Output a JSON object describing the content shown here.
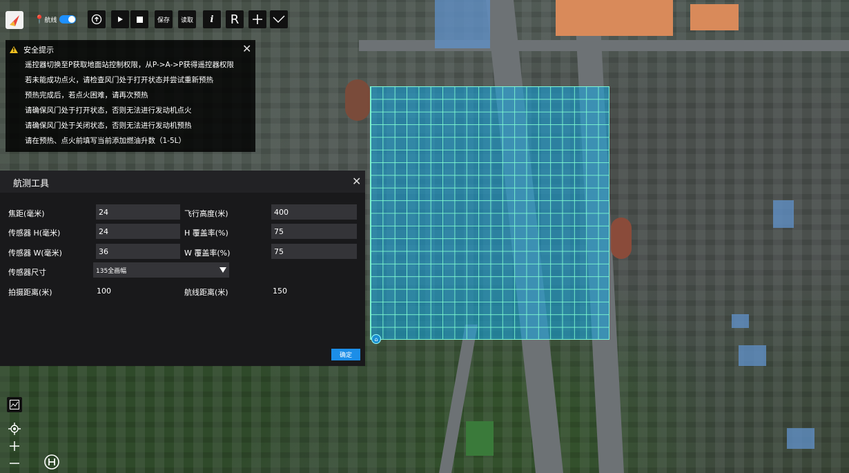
{
  "toolbar": {
    "route_label": "航线",
    "save_label": "保存",
    "read_label": "读取",
    "info_label": "i",
    "r_label": "R"
  },
  "safety": {
    "title": "安全提示",
    "lines": [
      "遥控器切换至P获取地面站控制权限，从P->A->P获得遥控器权限",
      "若未能成功点火，请检查风门处于打开状态并尝试重新预热",
      "预热完成后，若点火困难，请再次预热",
      "请确保风门处于打开状态，否则无法进行发动机点火",
      "请确保风门处于关闭状态，否则无法进行发动机预热",
      "请在预热、点火前填写当前添加燃油升数（1-5L）"
    ]
  },
  "survey": {
    "title": "航测工具",
    "focal_label": "焦距(毫米)",
    "focal_value": "24",
    "altitude_label": "飞行高度(米)",
    "altitude_value": "400",
    "sensor_h_label": "传感器 H(毫米)",
    "sensor_h_value": "24",
    "h_overlap_label": "H 覆盖率(%)",
    "h_overlap_value": "75",
    "sensor_w_label": "传感器 W(毫米)",
    "sensor_w_value": "36",
    "w_overlap_label": "W 覆盖率(%)",
    "w_overlap_value": "75",
    "sensor_size_label": "传感器尺寸",
    "sensor_size_value": "135全画幅",
    "shot_distance_label": "拍摄距离(米)",
    "shot_distance_value": "100",
    "route_distance_label": "航线距离(米)",
    "route_distance_value": "150",
    "confirm_label": "确定"
  },
  "icons": {
    "grid_corner": "home-icon"
  },
  "colors": {
    "accent": "#1c8ee8",
    "grid_fill": "#14aae6",
    "grid_line": "#82ffd2",
    "warning": "#f0c020"
  }
}
